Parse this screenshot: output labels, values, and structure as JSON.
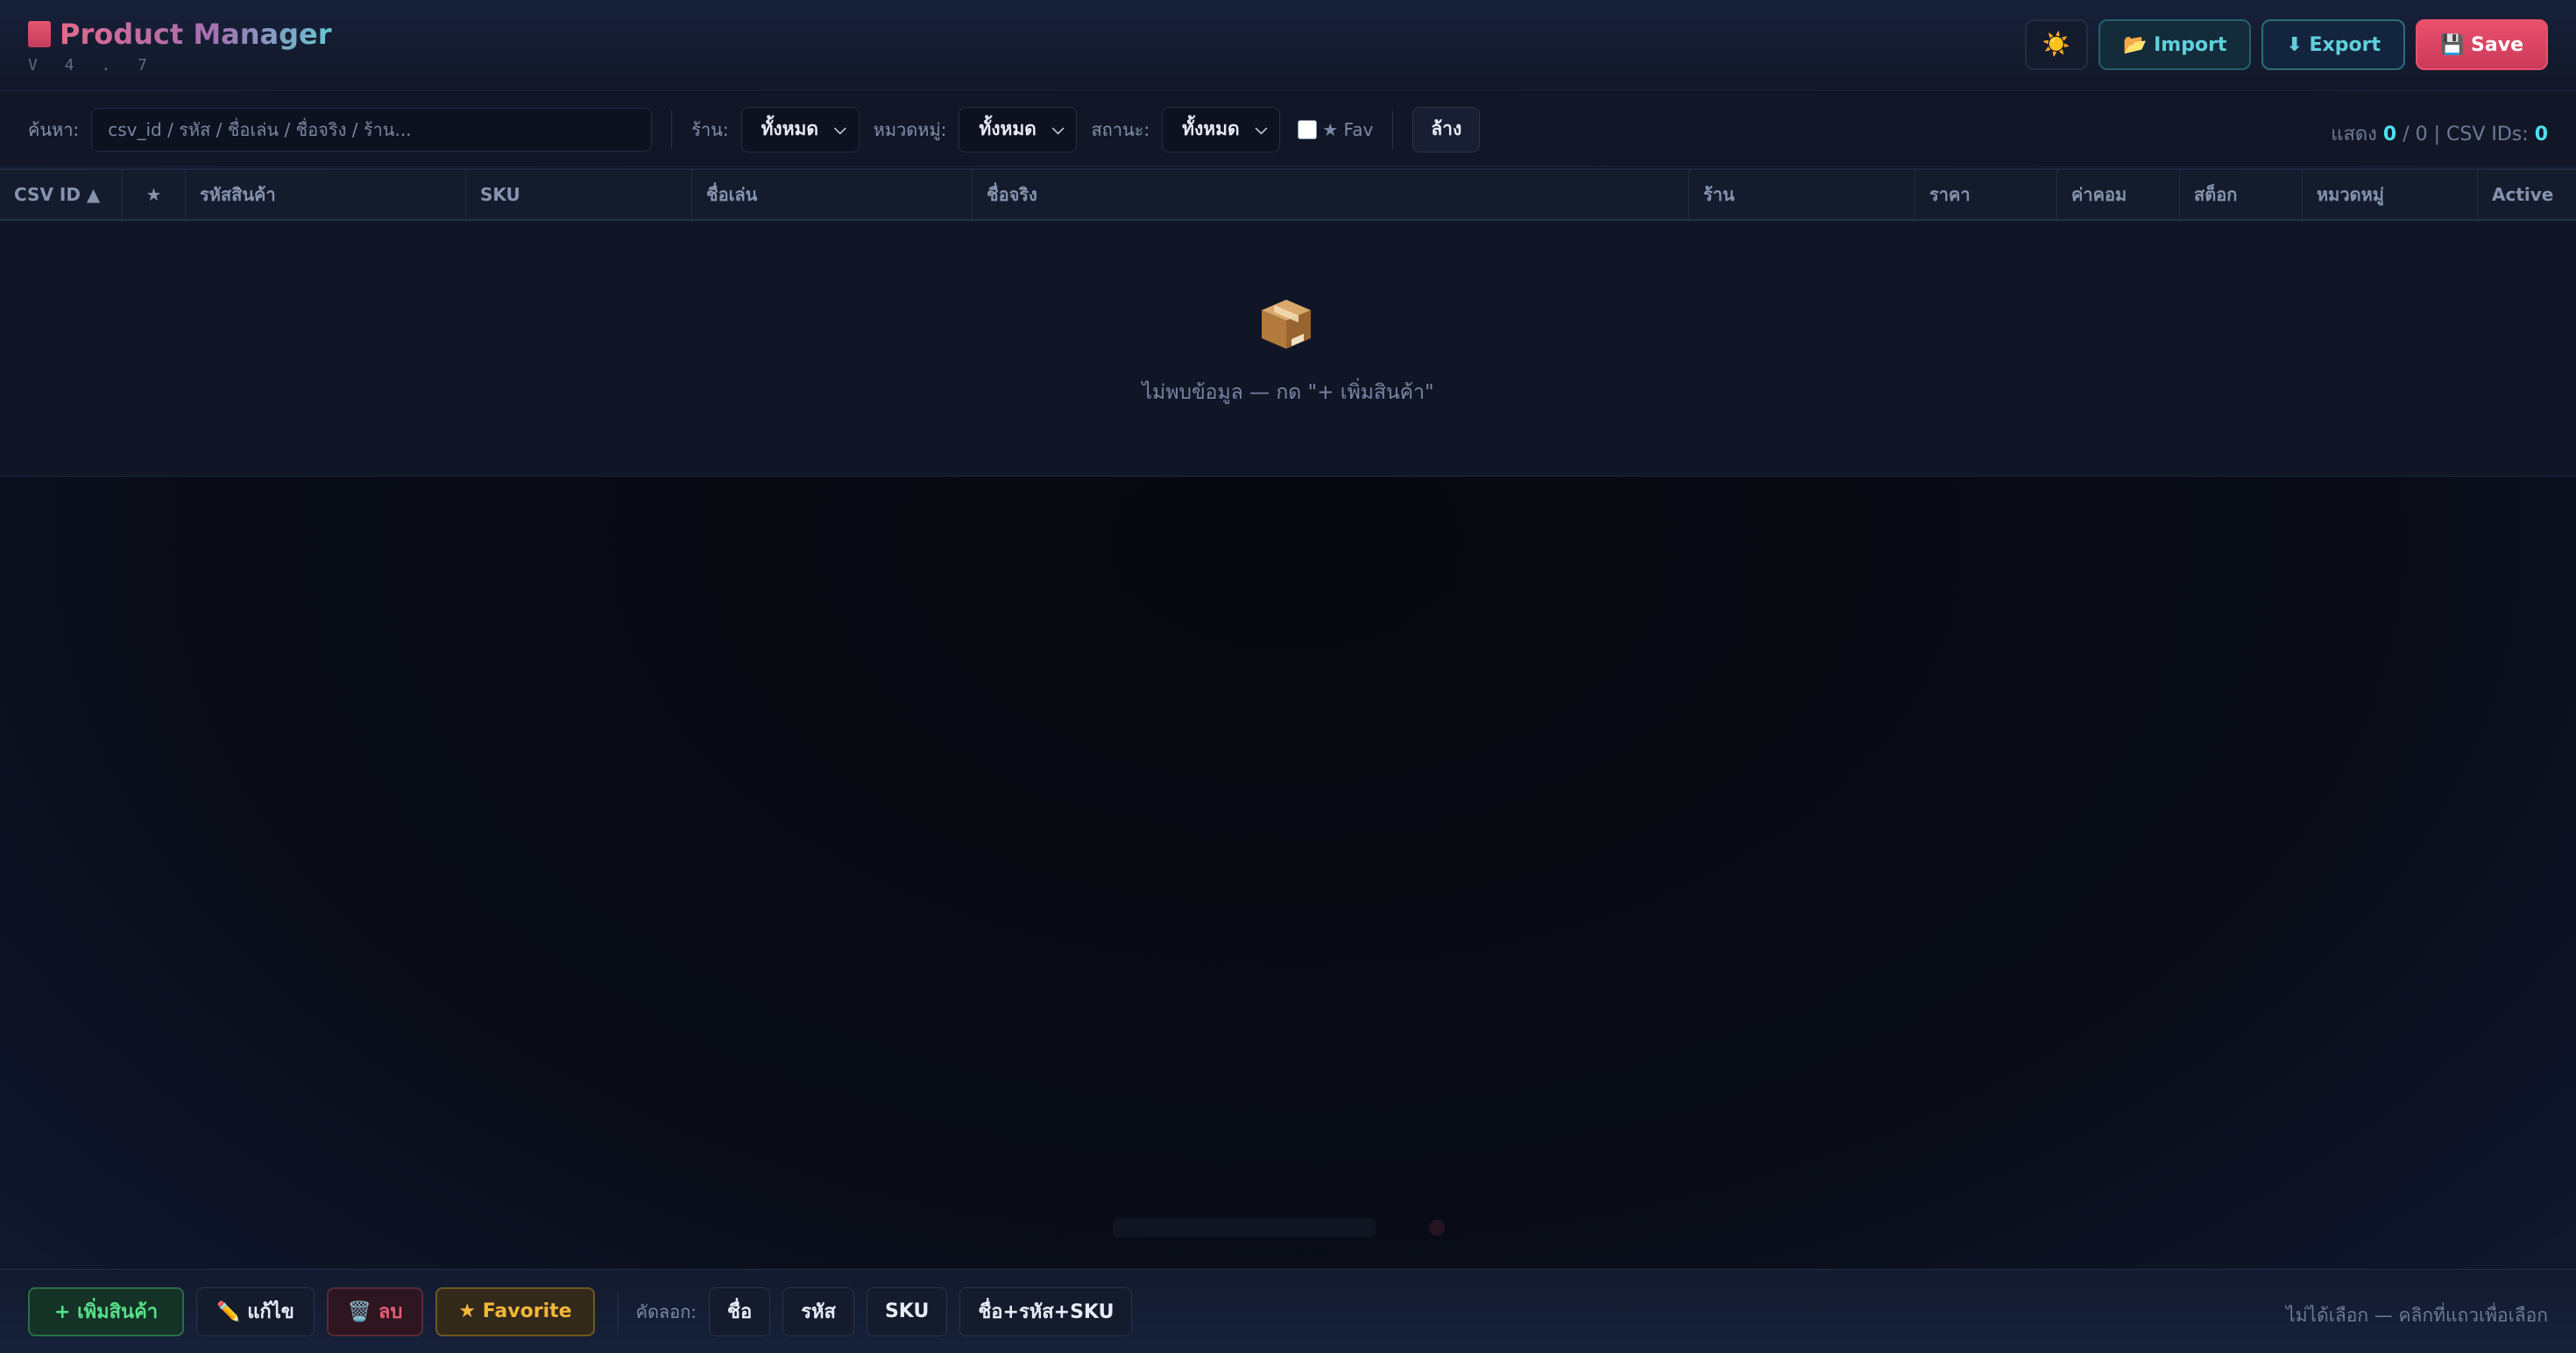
{
  "header": {
    "title": "Product Manager",
    "version": "V 4 . 7",
    "theme_icon": "☀️",
    "import_label": "📂 Import",
    "export_label": "⬇ Export",
    "save_label": "💾 Save"
  },
  "filters": {
    "search_label": "ค้นหา:",
    "search_placeholder": "csv_id / รหัส / ชื่อเล่น / ชื่อจริง / ร้าน...",
    "search_value": "",
    "shop_label": "ร้าน:",
    "shop_value": "ทั้งหมด",
    "category_label": "หมวดหมู่:",
    "category_value": "ทั้งหมด",
    "status_label": "สถานะ:",
    "status_value": "ทั้งหมด",
    "fav_label": "★ Fav",
    "fav_checked": false,
    "clear_label": "ล้าง",
    "count_prefix": "แสดง ",
    "shown": "0",
    "count_mid": " / 0 | CSV IDs: ",
    "csv_ids": "0"
  },
  "table": {
    "columns": [
      "CSV ID ▲",
      "★",
      "รหัสสินค้า",
      "SKU",
      "ชื่อเล่น",
      "ชื่อจริง",
      "ร้าน",
      "ราคา",
      "ค่าคอม",
      "สต็อก",
      "หมวดหมู่",
      "Active"
    ],
    "rows": [],
    "empty_icon": "package-icon",
    "empty_text": "ไม่พบข้อมูล — กด \"+ เพิ่มสินค้า\""
  },
  "actions": {
    "add_label": "+ เพิ่มสินค้า",
    "edit_label": "✏️ แก้ไข",
    "delete_label": "🗑️ ลบ",
    "favorite_label": "★ Favorite",
    "copy_label": "คัดลอก:",
    "copy_name": "ชื่อ",
    "copy_code": "รหัส",
    "copy_sku": "SKU",
    "copy_all": "ชื่อ+รหัส+SKU",
    "selection_status": "ไม่ได้เลือก — คลิกที่แถวเพื่อเลือก"
  },
  "colors": {
    "accent": "#4ee0ee",
    "save": "#e9506c",
    "add": "#56e08a",
    "delete": "#e85d74",
    "favorite": "#f0b73c"
  }
}
